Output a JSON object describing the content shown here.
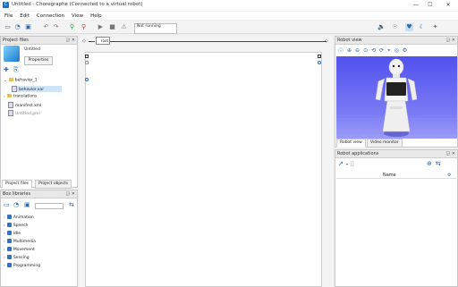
{
  "window": {
    "title": "Untitled - Choregraphe (Connected to a virtual robot)",
    "app_icon": "C",
    "minimize": "—",
    "maximize": "☐",
    "close": "✕"
  },
  "menu": [
    "File",
    "Edit",
    "Connection",
    "View",
    "Help"
  ],
  "toolbar": {
    "status_label": "Not running",
    "icons": [
      "new-file-icon",
      "open-file-icon",
      "save-icon",
      "undo-icon",
      "redo-icon",
      "connect-icon",
      "disconnect-icon",
      "play-icon",
      "stop-icon",
      "warning-icon"
    ]
  },
  "project_files": {
    "title": "Project files",
    "project_name": "Untitled",
    "properties_button": "Properties",
    "items": [
      {
        "label": "behavior_1",
        "type": "folder",
        "expanded": true
      },
      {
        "label": "behavior.xar",
        "type": "file",
        "selected": true
      },
      {
        "label": "translations",
        "type": "folder",
        "expanded": false
      },
      {
        "label": "manifest.xml",
        "type": "file"
      },
      {
        "label": "Untitled.pml",
        "type": "file"
      }
    ],
    "tabs": [
      "Project files",
      "Project objects"
    ]
  },
  "box_libraries": {
    "title": "Box libraries",
    "items": [
      "Animation",
      "Speech",
      "Idle",
      "Multimedia",
      "Movement",
      "Sensing",
      "Programming"
    ]
  },
  "flow": {
    "root_label": "root"
  },
  "robot_view": {
    "title": "Robot view",
    "tabs": [
      "Robot view",
      "Video monitor"
    ]
  },
  "robot_apps": {
    "title": "Robot applications",
    "column_name": "Name"
  },
  "colors": {
    "accent": "#2a6cb3",
    "robot_bg": "#6a6af2"
  }
}
